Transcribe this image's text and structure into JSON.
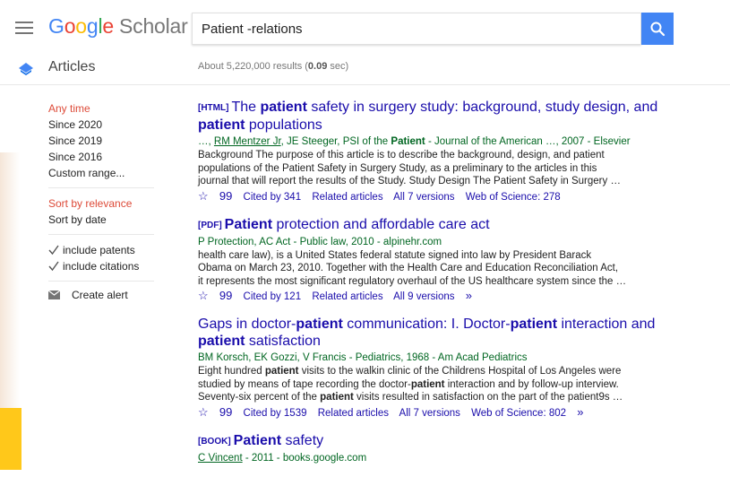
{
  "logo": {
    "g": "Google",
    "scholar": "Scholar"
  },
  "search": {
    "query": "Patient -relations"
  },
  "subheader": {
    "label": "Articles",
    "count_prefix": "About 5,220,000 results (",
    "count_time": "0.09",
    "count_suffix": " sec)"
  },
  "sidebar": {
    "time": [
      "Any time",
      "Since 2020",
      "Since 2019",
      "Since 2016",
      "Custom range..."
    ],
    "sort": [
      "Sort by relevance",
      "Sort by date"
    ],
    "checks": [
      "include patents",
      "include citations"
    ],
    "alert": "Create alert"
  },
  "results": [
    {
      "tag": "[HTML]",
      "meta_author_link": "RM Mentzer Jr",
      "meta_rest": ", JE Steeger, PSI of the ",
      "meta_bold": "Patient",
      "meta_end": " - Journal of the American …, 2007 - Elsevier",
      "snippet": [
        "Background The purpose of this article is to describe the background, design, and patient",
        "populations of the Patient Safety in Surgery Study, as a preliminary to the articles in this",
        "journal that will report the results of the Study. Study Design The Patient Safety in Surgery …"
      ],
      "cited": "Cited by 341",
      "related": "Related articles",
      "versions": "All 7 versions",
      "wos": "Web of Science: 278"
    },
    {
      "tag": "[PDF]",
      "meta": "P Protection, AC Act - Public law, 2010 - alpinehr.com",
      "snippet": [
        "health care law), is a United States federal statute signed into law by President Barack",
        "Obama on March 23, 2010. Together with the Health Care and Education Reconciliation Act,",
        "it represents the most significant regulatory overhaul of the US healthcare system since the …"
      ],
      "cited": "Cited by 121",
      "related": "Related articles",
      "versions": "All 9 versions"
    },
    {
      "meta": "BM Korsch, EK Gozzi, V Francis - Pediatrics, 1968 - Am Acad Pediatrics",
      "cited": "Cited by 1539",
      "related": "Related articles",
      "versions": "All 7 versions",
      "wos": "Web of Science: 802"
    },
    {
      "tag": "[BOOK]",
      "meta_author_link": "C Vincent",
      "meta_end": " - 2011 - books.google.com"
    }
  ],
  "colors": {
    "accent": "#4285f4",
    "link": "#1a0dab",
    "meta": "#006621",
    "selected": "#dd4b39"
  }
}
